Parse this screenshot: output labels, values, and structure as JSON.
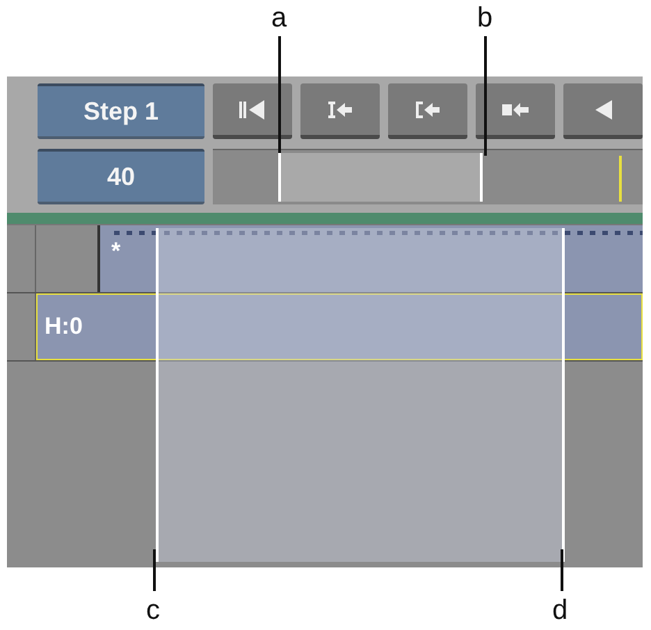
{
  "callouts_top": [
    {
      "label": "a"
    },
    {
      "label": "b"
    }
  ],
  "step_button": {
    "label": "Step 1"
  },
  "transport_buttons": [
    {
      "kind": "bars-triangle"
    },
    {
      "kind": "i-arrow"
    },
    {
      "kind": "bracket-arrow"
    },
    {
      "kind": "square-arrow"
    },
    {
      "kind": "triangle"
    }
  ],
  "step_value": {
    "label": "40"
  },
  "tracks": [
    {
      "kind": "effect",
      "label": "*",
      "selected": false
    },
    {
      "kind": "layer",
      "label": "H:0",
      "selected": true
    }
  ],
  "callouts_bottom": [
    {
      "label": "c"
    },
    {
      "label": "d"
    }
  ]
}
